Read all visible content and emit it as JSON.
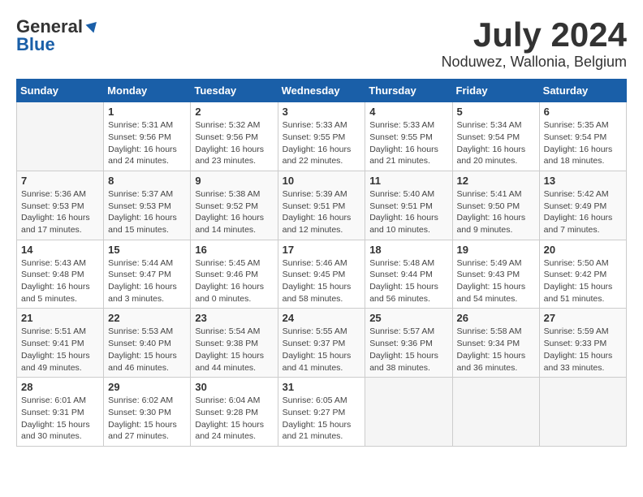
{
  "header": {
    "logo_general": "General",
    "logo_blue": "Blue",
    "month_year": "July 2024",
    "location": "Noduwez, Wallonia, Belgium"
  },
  "calendar": {
    "days_of_week": [
      "Sunday",
      "Monday",
      "Tuesday",
      "Wednesday",
      "Thursday",
      "Friday",
      "Saturday"
    ],
    "weeks": [
      [
        {
          "day": "",
          "sunrise": "",
          "sunset": "",
          "daylight": ""
        },
        {
          "day": "1",
          "sunrise": "Sunrise: 5:31 AM",
          "sunset": "Sunset: 9:56 PM",
          "daylight": "Daylight: 16 hours and 24 minutes."
        },
        {
          "day": "2",
          "sunrise": "Sunrise: 5:32 AM",
          "sunset": "Sunset: 9:56 PM",
          "daylight": "Daylight: 16 hours and 23 minutes."
        },
        {
          "day": "3",
          "sunrise": "Sunrise: 5:33 AM",
          "sunset": "Sunset: 9:55 PM",
          "daylight": "Daylight: 16 hours and 22 minutes."
        },
        {
          "day": "4",
          "sunrise": "Sunrise: 5:33 AM",
          "sunset": "Sunset: 9:55 PM",
          "daylight": "Daylight: 16 hours and 21 minutes."
        },
        {
          "day": "5",
          "sunrise": "Sunrise: 5:34 AM",
          "sunset": "Sunset: 9:54 PM",
          "daylight": "Daylight: 16 hours and 20 minutes."
        },
        {
          "day": "6",
          "sunrise": "Sunrise: 5:35 AM",
          "sunset": "Sunset: 9:54 PM",
          "daylight": "Daylight: 16 hours and 18 minutes."
        }
      ],
      [
        {
          "day": "7",
          "sunrise": "Sunrise: 5:36 AM",
          "sunset": "Sunset: 9:53 PM",
          "daylight": "Daylight: 16 hours and 17 minutes."
        },
        {
          "day": "8",
          "sunrise": "Sunrise: 5:37 AM",
          "sunset": "Sunset: 9:53 PM",
          "daylight": "Daylight: 16 hours and 15 minutes."
        },
        {
          "day": "9",
          "sunrise": "Sunrise: 5:38 AM",
          "sunset": "Sunset: 9:52 PM",
          "daylight": "Daylight: 16 hours and 14 minutes."
        },
        {
          "day": "10",
          "sunrise": "Sunrise: 5:39 AM",
          "sunset": "Sunset: 9:51 PM",
          "daylight": "Daylight: 16 hours and 12 minutes."
        },
        {
          "day": "11",
          "sunrise": "Sunrise: 5:40 AM",
          "sunset": "Sunset: 9:51 PM",
          "daylight": "Daylight: 16 hours and 10 minutes."
        },
        {
          "day": "12",
          "sunrise": "Sunrise: 5:41 AM",
          "sunset": "Sunset: 9:50 PM",
          "daylight": "Daylight: 16 hours and 9 minutes."
        },
        {
          "day": "13",
          "sunrise": "Sunrise: 5:42 AM",
          "sunset": "Sunset: 9:49 PM",
          "daylight": "Daylight: 16 hours and 7 minutes."
        }
      ],
      [
        {
          "day": "14",
          "sunrise": "Sunrise: 5:43 AM",
          "sunset": "Sunset: 9:48 PM",
          "daylight": "Daylight: 16 hours and 5 minutes."
        },
        {
          "day": "15",
          "sunrise": "Sunrise: 5:44 AM",
          "sunset": "Sunset: 9:47 PM",
          "daylight": "Daylight: 16 hours and 3 minutes."
        },
        {
          "day": "16",
          "sunrise": "Sunrise: 5:45 AM",
          "sunset": "Sunset: 9:46 PM",
          "daylight": "Daylight: 16 hours and 0 minutes."
        },
        {
          "day": "17",
          "sunrise": "Sunrise: 5:46 AM",
          "sunset": "Sunset: 9:45 PM",
          "daylight": "Daylight: 15 hours and 58 minutes."
        },
        {
          "day": "18",
          "sunrise": "Sunrise: 5:48 AM",
          "sunset": "Sunset: 9:44 PM",
          "daylight": "Daylight: 15 hours and 56 minutes."
        },
        {
          "day": "19",
          "sunrise": "Sunrise: 5:49 AM",
          "sunset": "Sunset: 9:43 PM",
          "daylight": "Daylight: 15 hours and 54 minutes."
        },
        {
          "day": "20",
          "sunrise": "Sunrise: 5:50 AM",
          "sunset": "Sunset: 9:42 PM",
          "daylight": "Daylight: 15 hours and 51 minutes."
        }
      ],
      [
        {
          "day": "21",
          "sunrise": "Sunrise: 5:51 AM",
          "sunset": "Sunset: 9:41 PM",
          "daylight": "Daylight: 15 hours and 49 minutes."
        },
        {
          "day": "22",
          "sunrise": "Sunrise: 5:53 AM",
          "sunset": "Sunset: 9:40 PM",
          "daylight": "Daylight: 15 hours and 46 minutes."
        },
        {
          "day": "23",
          "sunrise": "Sunrise: 5:54 AM",
          "sunset": "Sunset: 9:38 PM",
          "daylight": "Daylight: 15 hours and 44 minutes."
        },
        {
          "day": "24",
          "sunrise": "Sunrise: 5:55 AM",
          "sunset": "Sunset: 9:37 PM",
          "daylight": "Daylight: 15 hours and 41 minutes."
        },
        {
          "day": "25",
          "sunrise": "Sunrise: 5:57 AM",
          "sunset": "Sunset: 9:36 PM",
          "daylight": "Daylight: 15 hours and 38 minutes."
        },
        {
          "day": "26",
          "sunrise": "Sunrise: 5:58 AM",
          "sunset": "Sunset: 9:34 PM",
          "daylight": "Daylight: 15 hours and 36 minutes."
        },
        {
          "day": "27",
          "sunrise": "Sunrise: 5:59 AM",
          "sunset": "Sunset: 9:33 PM",
          "daylight": "Daylight: 15 hours and 33 minutes."
        }
      ],
      [
        {
          "day": "28",
          "sunrise": "Sunrise: 6:01 AM",
          "sunset": "Sunset: 9:31 PM",
          "daylight": "Daylight: 15 hours and 30 minutes."
        },
        {
          "day": "29",
          "sunrise": "Sunrise: 6:02 AM",
          "sunset": "Sunset: 9:30 PM",
          "daylight": "Daylight: 15 hours and 27 minutes."
        },
        {
          "day": "30",
          "sunrise": "Sunrise: 6:04 AM",
          "sunset": "Sunset: 9:28 PM",
          "daylight": "Daylight: 15 hours and 24 minutes."
        },
        {
          "day": "31",
          "sunrise": "Sunrise: 6:05 AM",
          "sunset": "Sunset: 9:27 PM",
          "daylight": "Daylight: 15 hours and 21 minutes."
        },
        {
          "day": "",
          "sunrise": "",
          "sunset": "",
          "daylight": ""
        },
        {
          "day": "",
          "sunrise": "",
          "sunset": "",
          "daylight": ""
        },
        {
          "day": "",
          "sunrise": "",
          "sunset": "",
          "daylight": ""
        }
      ]
    ]
  }
}
